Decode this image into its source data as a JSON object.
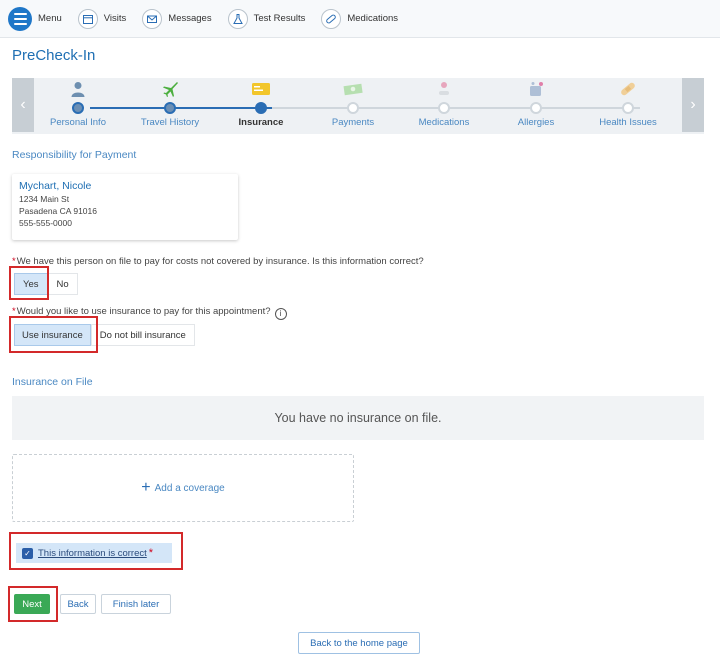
{
  "nav": {
    "menu_label": "Menu",
    "items": [
      {
        "label": "Visits",
        "icon": "calendar-icon"
      },
      {
        "label": "Messages",
        "icon": "envelope-icon"
      },
      {
        "label": "Test Results",
        "icon": "flask-icon"
      },
      {
        "label": "Medications",
        "icon": "pill-icon"
      }
    ]
  },
  "page_title": "PreCheck-In",
  "steps": [
    {
      "label": "Personal Info",
      "state": "done",
      "icon": "person-icon"
    },
    {
      "label": "Travel History",
      "state": "done",
      "icon": "airplane-icon"
    },
    {
      "label": "Insurance",
      "state": "current",
      "icon": "insurance-card-icon"
    },
    {
      "label": "Payments",
      "state": "pending",
      "icon": "money-icon"
    },
    {
      "label": "Medications",
      "state": "pending",
      "icon": "medication-icon"
    },
    {
      "label": "Allergies",
      "state": "pending",
      "icon": "allergy-icon"
    },
    {
      "label": "Health Issues",
      "state": "pending",
      "icon": "bandage-icon"
    }
  ],
  "responsibility": {
    "title": "Responsibility for Payment",
    "name": "Mychart, Nicole",
    "address1": "1234 Main St",
    "address2": "Pasadena CA 91016",
    "phone": "555-555-0000"
  },
  "q1": {
    "text": "We have this person on file to pay for costs not covered by insurance. Is this information correct?",
    "options": [
      "Yes",
      "No"
    ],
    "selected": "Yes"
  },
  "q2": {
    "text": "Would you like to use insurance to pay for this appointment?",
    "options": [
      "Use insurance",
      "Do not bill insurance"
    ],
    "selected": "Use insurance"
  },
  "insurance": {
    "title": "Insurance on File",
    "empty_text": "You have no insurance on file.",
    "add_label": "Add a coverage"
  },
  "confirm": {
    "label": "This information is correct",
    "checked": true
  },
  "buttons": {
    "next": "Next",
    "back": "Back",
    "finish_later": "Finish later",
    "home": "Back to the home page"
  },
  "colors": {
    "accent": "#1f77c8",
    "highlight": "#d3292a",
    "next_green": "#3aa956"
  }
}
